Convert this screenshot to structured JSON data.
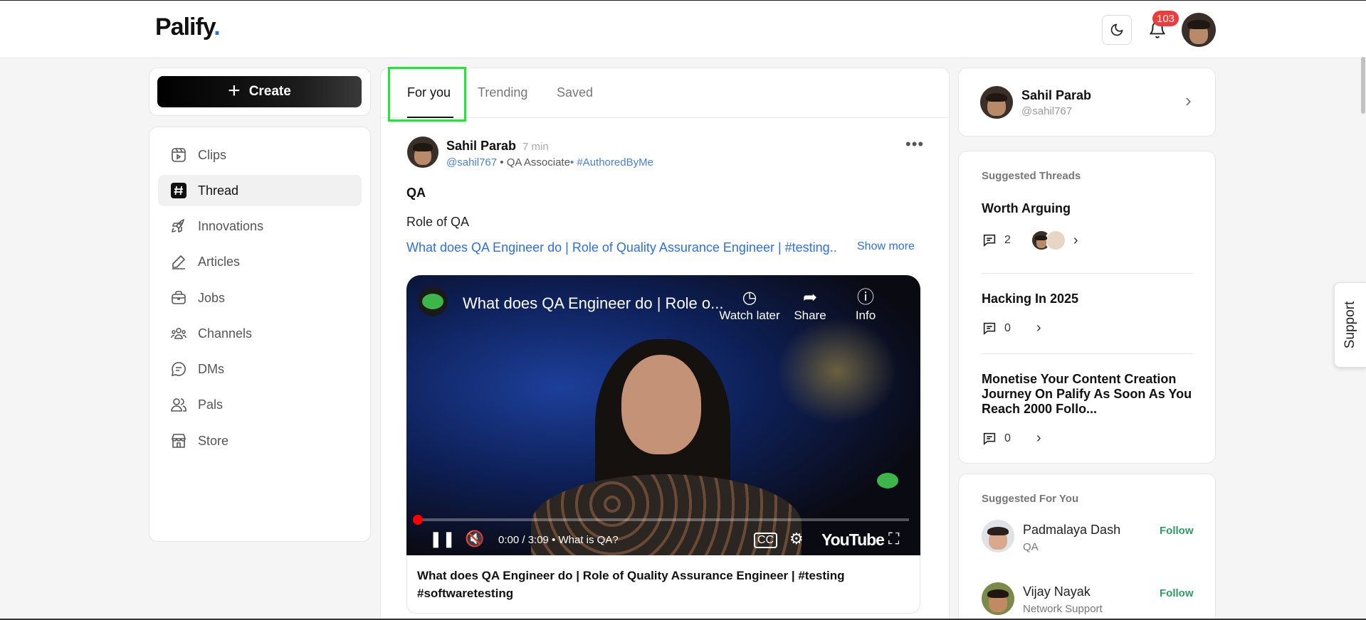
{
  "header": {
    "logo_text": "Palify",
    "logo_dot": ".",
    "notification_count": "103"
  },
  "sidebar": {
    "create_label": "Create",
    "items": [
      {
        "label": "Clips",
        "icon": "clips-icon"
      },
      {
        "label": "Thread",
        "icon": "hashtag-icon",
        "active": true
      },
      {
        "label": "Innovations",
        "icon": "rocket-icon"
      },
      {
        "label": "Articles",
        "icon": "pen-icon"
      },
      {
        "label": "Jobs",
        "icon": "briefcase-icon"
      },
      {
        "label": "Channels",
        "icon": "people-group-icon"
      },
      {
        "label": "DMs",
        "icon": "chat-bubble-icon"
      },
      {
        "label": "Pals",
        "icon": "pals-icon"
      },
      {
        "label": "Store",
        "icon": "store-icon"
      }
    ]
  },
  "feed": {
    "tabs": [
      {
        "label": "For you",
        "active": true
      },
      {
        "label": "Trending"
      },
      {
        "label": "Saved"
      }
    ],
    "post": {
      "author": "Sahil Parab",
      "time": "7 min",
      "handle": "@sahil767",
      "role": "QA Associate",
      "tag": "#AuthoredByMe",
      "title": "QA",
      "body": "Role of QA",
      "link_text": "What does QA Engineer do | Role of Quality Assurance Engineer | #testing..",
      "show_more": "Show more",
      "video": {
        "title": "What does QA Engineer do | Role o...",
        "watch_later": "Watch later",
        "share": "Share",
        "info": "Info",
        "time": "0:00 / 3:09",
        "chapter": "What is QA?",
        "brand": "YouTube",
        "progress_fraction": 0.0
      },
      "caption": "What does QA Engineer do | Role of Quality Assurance Engineer | #testing #softwaretesting"
    }
  },
  "right": {
    "profile": {
      "name": "Sahil Parab",
      "handle": "@sahil767"
    },
    "suggested_threads_title": "Suggested Threads",
    "threads": [
      {
        "title": "Worth Arguing",
        "comments": "2"
      },
      {
        "title": "Hacking In 2025",
        "comments": "0"
      },
      {
        "title": "Monetise Your Content Creation Journey On Palify As Soon As You Reach 2000 Follo...",
        "comments": "0"
      }
    ],
    "suggested_for_you_title": "Suggested For You",
    "suggestions": [
      {
        "name": "Padmalaya Dash",
        "sub": "QA",
        "action": "Follow"
      },
      {
        "name": "Vijay Nayak",
        "sub": "Network Support",
        "action": "Follow"
      }
    ]
  },
  "support_label": "Support",
  "colors": {
    "accent_blue": "#2f6fe0",
    "badge_red": "#ef3b3b",
    "follow_green": "#2f9a66",
    "highlight_green": "#1ee836"
  }
}
